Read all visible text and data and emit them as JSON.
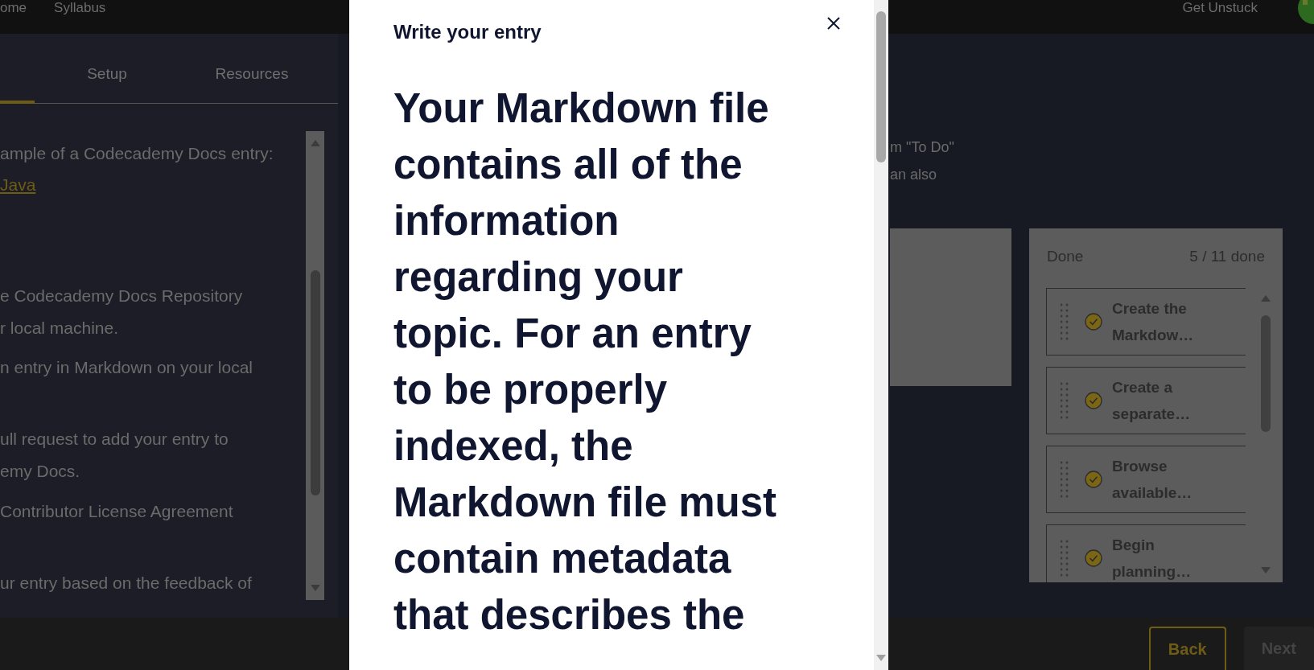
{
  "top_bar": {
    "nav": [
      "ome",
      "Syllabus"
    ],
    "help": "Get Unstuck"
  },
  "sidebar": {
    "active_tab": {
      "selected": true
    },
    "tabs": [
      {
        "label": "Setup",
        "selected": false
      },
      {
        "label": "Resources",
        "selected": false
      }
    ],
    "blocks": [
      {
        "lines": [
          "ample of a Codecademy Docs entry:"
        ],
        "link": "Java"
      },
      {
        "lines": [
          "e Codecademy Docs Repository",
          "r local machine."
        ]
      },
      {
        "lines": [
          "n entry in Markdown on your local"
        ]
      },
      {
        "lines": [
          "ull request to add your entry to",
          "emy Docs."
        ]
      },
      {
        "lines": [
          "Contributor License Agreement"
        ]
      },
      {
        "lines": [
          "ur entry based on the feedback of"
        ]
      }
    ]
  },
  "board": {
    "intro_lines": [
      "m \"To Do\"",
      "an also"
    ],
    "done_column": {
      "title": "Done",
      "count": "5 / 11 done",
      "cards": [
        {
          "text": "Create the Markdow…",
          "checked": true
        },
        {
          "text": "Create a separate…",
          "checked": true
        },
        {
          "text": "Browse available…",
          "checked": true
        },
        {
          "text": "Begin planning…",
          "checked": true
        }
      ]
    }
  },
  "modal": {
    "title": "Write your entry",
    "body": "Your Markdown file contains all of the information regarding your topic. For an entry to be properly indexed, the Markdown file must contain metadata that describes the"
  },
  "footer": {
    "buttons": [
      {
        "label": "Back",
        "kind": "outline"
      },
      {
        "label": "Next",
        "kind": "disabled"
      }
    ]
  }
}
